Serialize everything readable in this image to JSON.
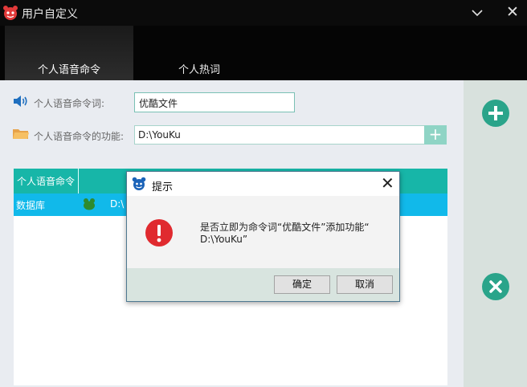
{
  "window": {
    "title": "用户自定义",
    "minimize_icon": "chevron-down-icon",
    "close_glyph": "✕"
  },
  "tabs": [
    {
      "label": "个人语音命令",
      "active": true
    },
    {
      "label": "个人热词",
      "active": false
    }
  ],
  "form": {
    "command_label": "个人语音命令词:",
    "command_value": "优酷文件",
    "function_label": "个人语音命令的功能:",
    "function_value": "D:\\YouKu",
    "function_add": "+"
  },
  "table": {
    "column_header": "个人语音命令",
    "rows": [
      {
        "name": "数据库",
        "path": "D:\\"
      }
    ]
  },
  "dialog": {
    "title": "提示",
    "close_glyph": "✕",
    "message_line1": "是否立即为命令词“优酷文件”添加功能“",
    "message_line2": "D:\\YouKu”",
    "ok_label": "确定",
    "cancel_label": "取消"
  },
  "colors": {
    "accent": "#17b6a8",
    "selection": "#11b9ea",
    "green_button": "#2aa48a",
    "error": "#e02a2f",
    "title_bar": "#0b0b0b"
  }
}
